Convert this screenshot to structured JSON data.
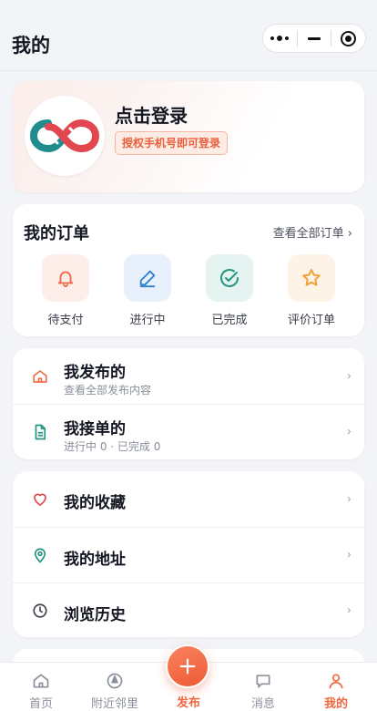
{
  "header": {
    "title": "我的"
  },
  "capsule": {
    "icons": [
      "more-dots-icon",
      "minimize-icon",
      "close-target-icon"
    ]
  },
  "login": {
    "title": "点击登录",
    "badge": "授权手机号即可登录",
    "logo_icon": "infinity-logo-icon"
  },
  "orders": {
    "title": "我的订单",
    "view_all": "查看全部订单 ›",
    "items": [
      {
        "label": "待支付",
        "icon": "bell-icon",
        "bg": "#fdeee9",
        "color": "#ef6a47"
      },
      {
        "label": "进行中",
        "icon": "pencil-icon",
        "bg": "#e8f1fb",
        "color": "#2f7fcf"
      },
      {
        "label": "已完成",
        "icon": "check-circle-icon",
        "bg": "#e6f4f1",
        "color": "#22957e"
      },
      {
        "label": "评价订单",
        "icon": "star-icon",
        "bg": "#fdf3e6",
        "color": "#f0a13a"
      }
    ]
  },
  "list1": [
    {
      "title": "我发布的",
      "sub": "查看全部发布内容",
      "icon": "home-icon",
      "color": "#ef6a47"
    },
    {
      "title": "我接单的",
      "sub": "进行中 0 · 已完成 0",
      "icon": "document-icon",
      "color": "#22957e"
    }
  ],
  "list2": [
    {
      "title": "我的收藏",
      "icon": "heart-icon",
      "color": "#e2474f"
    },
    {
      "title": "我的地址",
      "icon": "location-pin-icon",
      "color": "#22957e"
    },
    {
      "title": "浏览历史",
      "icon": "clock-icon",
      "color": "#3d4250"
    }
  ],
  "chevron": "›",
  "tabbar": {
    "tabs": [
      {
        "label": "首页",
        "icon": "home-tab-icon"
      },
      {
        "label": "附近邻里",
        "icon": "compass-icon"
      },
      {
        "label": "发布",
        "icon": "plus-icon"
      },
      {
        "label": "消息",
        "icon": "chat-icon"
      },
      {
        "label": "我的",
        "icon": "user-icon"
      }
    ],
    "active_color": "#f0673f"
  }
}
